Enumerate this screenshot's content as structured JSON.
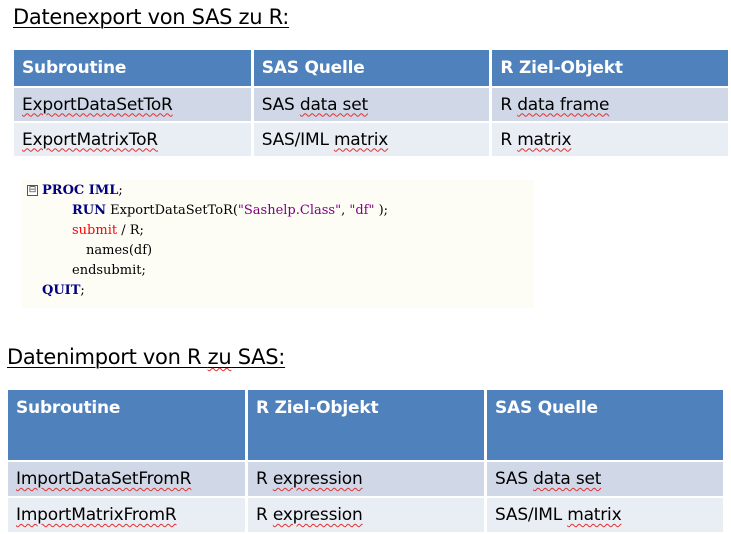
{
  "export_section": {
    "title": "Datenexport von SAS zu R:",
    "headers": [
      "Subroutine",
      "SAS  Quelle",
      "R Ziel-Objekt"
    ],
    "rows": [
      [
        "ExportDataSetToR",
        "SAS data set",
        "R data frame"
      ],
      [
        "ExportMatrixToR",
        "SAS/IML matrix",
        "R matrix"
      ]
    ]
  },
  "code_sample": {
    "fold_icon": "⊟",
    "lines": [
      {
        "parts": [
          {
            "text": "PROC IML",
            "style": "kw"
          },
          {
            "text": ";",
            "style": "plain"
          }
        ]
      },
      {
        "parts": [
          {
            "text": "RUN",
            "style": "kw"
          },
          {
            "text": " ExportDataSetToR(",
            "style": "plain"
          },
          {
            "text": "\"Sashelp.Class\"",
            "style": "str"
          },
          {
            "text": ", ",
            "style": "plain"
          },
          {
            "text": "\"df\"",
            "style": "str"
          },
          {
            "text": " );",
            "style": "plain"
          }
        ]
      },
      {
        "parts": [
          {
            "text": "submit",
            "style": "red"
          },
          {
            "text": " / R;",
            "style": "plain"
          }
        ]
      },
      {
        "parts": [
          {
            "text": "names(df)",
            "style": "plain"
          }
        ]
      },
      {
        "parts": [
          {
            "text": "endsubmit;",
            "style": "plain"
          }
        ]
      },
      {
        "parts": [
          {
            "text": "QUIT",
            "style": "kw"
          },
          {
            "text": ";",
            "style": "plain"
          }
        ]
      }
    ]
  },
  "import_section": {
    "title": "Datenimport von R zu SAS:",
    "headers": [
      "Subroutine",
      "R Ziel-Objekt",
      "SAS  Quelle"
    ],
    "rows": [
      [
        "ImportDataSetFromR",
        "R expression",
        "SAS data set"
      ],
      [
        "ImportMatrixFromR",
        "R expression",
        "SAS/IML matrix"
      ]
    ]
  }
}
